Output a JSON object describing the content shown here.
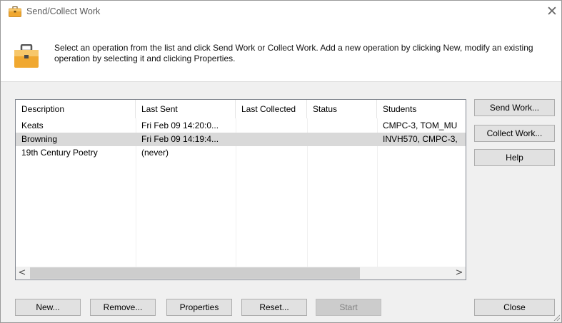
{
  "window": {
    "title": "Send/Collect Work",
    "close_glyph": "✕"
  },
  "header": {
    "instructions": "Select an operation from the list and click Send Work or Collect Work. Add a new operation by clicking New, modify an existing operation by selecting it and clicking Properties.",
    "icon": "briefcase-icon"
  },
  "list": {
    "columns": [
      "Description",
      "Last Sent",
      "Last Collected",
      "Status",
      "Students"
    ],
    "rows": [
      {
        "description": "Keats",
        "last_sent": "Fri Feb 09 14:20:0...",
        "last_collected": "",
        "status": "",
        "students": "CMPC-3, TOM_MU",
        "selected": false
      },
      {
        "description": "Browning",
        "last_sent": "Fri Feb 09 14:19:4...",
        "last_collected": "",
        "status": "",
        "students": "INVH570, CMPC-3,",
        "selected": true
      },
      {
        "description": "19th Century Poetry",
        "last_sent": "(never)",
        "last_collected": "",
        "status": "",
        "students": "",
        "selected": false
      }
    ],
    "scroll_left": "<",
    "scroll_right": ">"
  },
  "side_buttons": {
    "send": "Send Work...",
    "collect": "Collect Work...",
    "help": "Help"
  },
  "bottom_buttons": {
    "new": "New...",
    "remove": "Remove...",
    "properties": "Properties",
    "reset": "Reset...",
    "start": "Start",
    "close": "Close"
  },
  "colors": {
    "accent_icon": "#f0a830",
    "selected_row": "#d9d9d9",
    "dialog_bg": "#f0f0f0"
  }
}
